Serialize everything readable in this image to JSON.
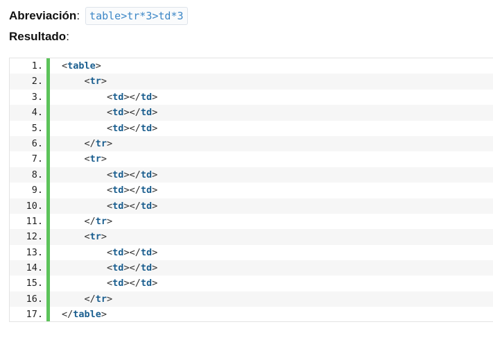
{
  "abbreviation": {
    "label": "Abreviación",
    "colon": ":",
    "code": "table>tr*3>td*3"
  },
  "result": {
    "label": "Resultado",
    "colon": ":"
  },
  "code_lines": [
    {
      "number": "1.",
      "indent": 0,
      "kind": "open",
      "tag": "table"
    },
    {
      "number": "2.",
      "indent": 1,
      "kind": "open",
      "tag": "tr"
    },
    {
      "number": "3.",
      "indent": 2,
      "kind": "pair",
      "tag": "td"
    },
    {
      "number": "4.",
      "indent": 2,
      "kind": "pair",
      "tag": "td"
    },
    {
      "number": "5.",
      "indent": 2,
      "kind": "pair",
      "tag": "td"
    },
    {
      "number": "6.",
      "indent": 1,
      "kind": "close",
      "tag": "tr"
    },
    {
      "number": "7.",
      "indent": 1,
      "kind": "open",
      "tag": "tr"
    },
    {
      "number": "8.",
      "indent": 2,
      "kind": "pair",
      "tag": "td"
    },
    {
      "number": "9.",
      "indent": 2,
      "kind": "pair",
      "tag": "td"
    },
    {
      "number": "10.",
      "indent": 2,
      "kind": "pair",
      "tag": "td"
    },
    {
      "number": "11.",
      "indent": 1,
      "kind": "close",
      "tag": "tr"
    },
    {
      "number": "12.",
      "indent": 1,
      "kind": "open",
      "tag": "tr"
    },
    {
      "number": "13.",
      "indent": 2,
      "kind": "pair",
      "tag": "td"
    },
    {
      "number": "14.",
      "indent": 2,
      "kind": "pair",
      "tag": "td"
    },
    {
      "number": "15.",
      "indent": 2,
      "kind": "pair",
      "tag": "td"
    },
    {
      "number": "16.",
      "indent": 1,
      "kind": "close",
      "tag": "tr"
    },
    {
      "number": "17.",
      "indent": 0,
      "kind": "close",
      "tag": "table"
    }
  ],
  "colors": {
    "tag": "#1a5e8f",
    "gutter_bar": "#5cc35a",
    "abbr_code": "#3b86c6"
  }
}
